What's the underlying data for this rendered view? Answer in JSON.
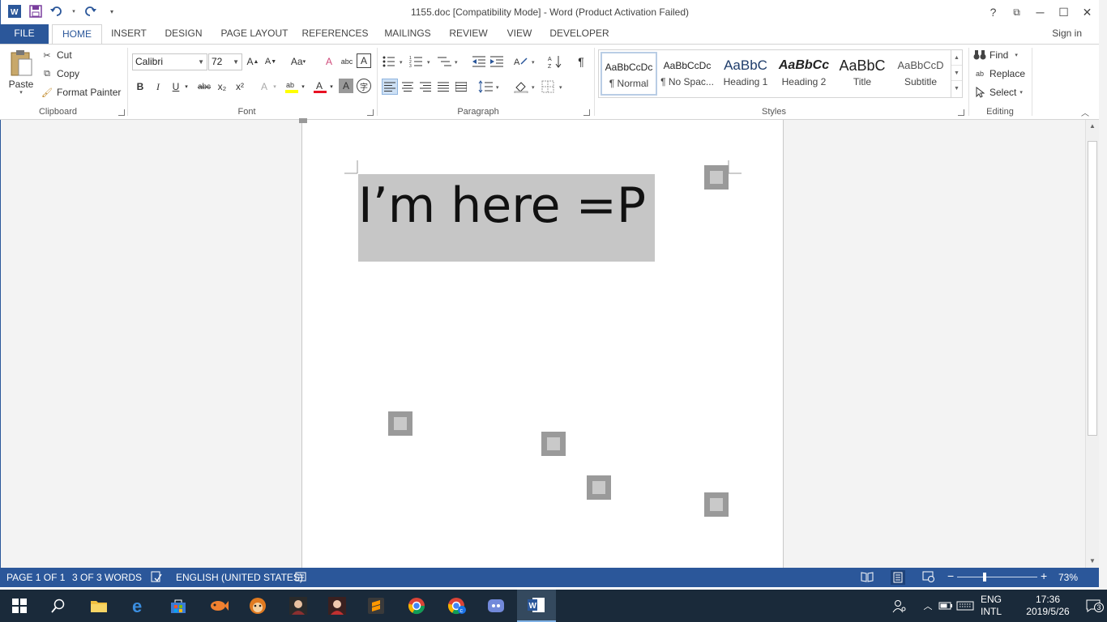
{
  "window": {
    "title": "1155.doc [Compatibility Mode] - Word (Product Activation Failed)",
    "help": "?",
    "restore_ribbon": "⧉",
    "minimize": "─",
    "maximize": "☐",
    "close": "✕"
  },
  "tabs": {
    "file": "FILE",
    "home": "HOME",
    "insert": "INSERT",
    "design": "DESIGN",
    "page_layout": "PAGE LAYOUT",
    "references": "REFERENCES",
    "mailings": "MAILINGS",
    "review": "REVIEW",
    "view": "VIEW",
    "developer": "DEVELOPER",
    "sign_in": "Sign in"
  },
  "clipboard": {
    "paste": "Paste",
    "cut": "Cut",
    "copy": "Copy",
    "format_painter": "Format Painter",
    "label": "Clipboard"
  },
  "font": {
    "name": "Calibri",
    "size": "72",
    "label": "Font",
    "bold": "B",
    "italic": "I",
    "underline": "U",
    "strike": "abc",
    "subscript": "x₂",
    "superscript": "x²"
  },
  "paragraph": {
    "label": "Paragraph"
  },
  "styles": {
    "label": "Styles",
    "items": [
      {
        "sample": "AaBbCcDc",
        "name": "¶ Normal"
      },
      {
        "sample": "AaBbCcDc",
        "name": "¶ No Spac..."
      },
      {
        "sample": "AaBbC",
        "name": "Heading 1"
      },
      {
        "sample": "AaBbCc",
        "name": "Heading 2"
      },
      {
        "sample": "AaBbC",
        "name": "Title"
      },
      {
        "sample": "AaBbCcD",
        "name": "Subtitle"
      }
    ]
  },
  "editing": {
    "find": "Find",
    "replace": "Replace",
    "select": "Select",
    "label": "Editing"
  },
  "document": {
    "text": "I’m here =P"
  },
  "status": {
    "page": "PAGE 1 OF 1",
    "words": "3 OF 3 WORDS",
    "language": "ENGLISH (UNITED STATES)",
    "zoom": "73%",
    "zoom_level": 0.73
  },
  "taskbar": {
    "lang_top": "ENG",
    "lang_bottom": "INTL",
    "time": "17:36",
    "date": "2019/5/26",
    "notifications": "3"
  },
  "colors": {
    "accent": "#2b579a",
    "taskbar": "#1a2a3a"
  }
}
